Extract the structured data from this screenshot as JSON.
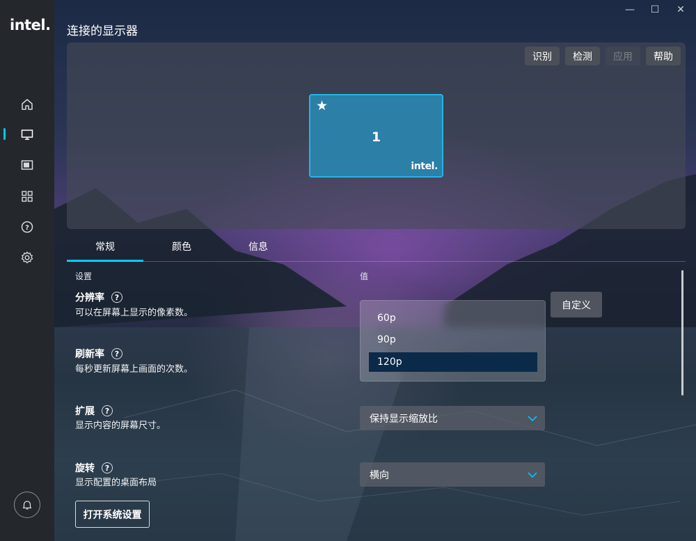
{
  "sidebar": {
    "logo": "intel.",
    "items": [
      {
        "icon": "home-icon"
      },
      {
        "icon": "display-icon",
        "active": true
      },
      {
        "icon": "video-icon"
      },
      {
        "icon": "apps-grid-icon"
      },
      {
        "icon": "help-circle-icon"
      },
      {
        "icon": "gear-icon"
      }
    ],
    "notifications_icon": "bell-icon"
  },
  "window_controls": {
    "minimize": "—",
    "maximize": "☐",
    "close": "✕"
  },
  "page": {
    "title": "连接的显示器"
  },
  "preview": {
    "buttons": {
      "identify": "识别",
      "detect": "检测",
      "apply": "应用",
      "help": "帮助"
    },
    "monitor": {
      "star": "★",
      "number": "1",
      "brand": "intel."
    }
  },
  "tabs": [
    {
      "label": "常规",
      "active": true
    },
    {
      "label": "颜色"
    },
    {
      "label": "信息"
    }
  ],
  "columns": {
    "setting": "设置",
    "value": "值"
  },
  "settings": {
    "resolution": {
      "title": "分辨率",
      "desc": "可以在屏幕上显示的像素数。",
      "custom_label": "自定义"
    },
    "refresh": {
      "title": "刷新率",
      "desc": "每秒更新屏幕上画面的次数。",
      "options": [
        "60p",
        "90p",
        "120p"
      ],
      "selected": "120p"
    },
    "scaling": {
      "title": "扩展",
      "desc": "显示内容的屏幕尺寸。",
      "value": "保持显示缩放比"
    },
    "rotation": {
      "title": "旋转",
      "desc": "显示配置的桌面布局",
      "value": "横向"
    }
  },
  "open_settings_button": "打开系统设置",
  "help_glyph": "?",
  "colors": {
    "accent": "#00c7fd",
    "monitor_fill": "#2c7fa6",
    "selected_option": "#0b2a4a"
  }
}
